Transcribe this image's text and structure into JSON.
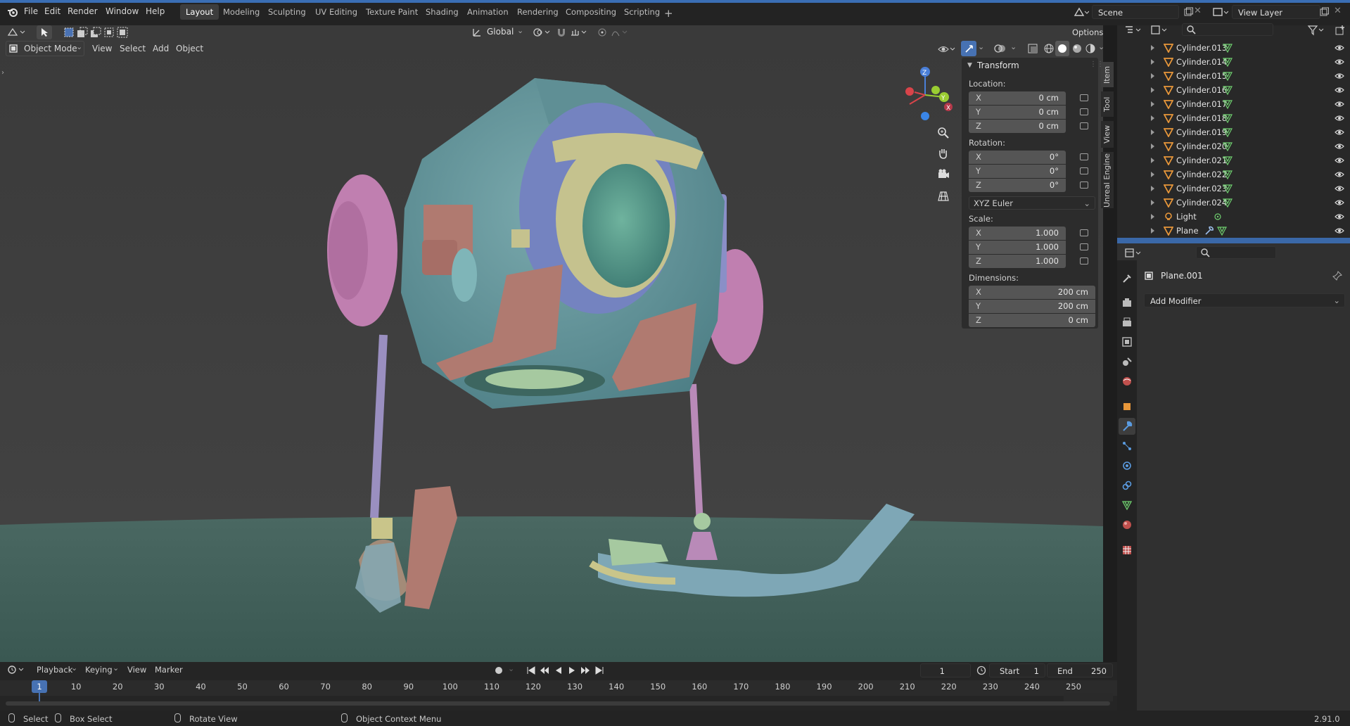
{
  "menu": [
    "File",
    "Edit",
    "Render",
    "Window",
    "Help"
  ],
  "workspaces": [
    {
      "label": "Layout",
      "active": true
    },
    {
      "label": "Modeling",
      "active": false
    },
    {
      "label": "Sculpting",
      "active": false
    },
    {
      "label": "UV Editing",
      "active": false
    },
    {
      "label": "Texture Paint",
      "active": false
    },
    {
      "label": "Shading",
      "active": false
    },
    {
      "label": "Animation",
      "active": false
    },
    {
      "label": "Rendering",
      "active": false
    },
    {
      "label": "Compositing",
      "active": false
    },
    {
      "label": "Scripting",
      "active": false
    }
  ],
  "add_workspace": "+",
  "scene": {
    "name": "Scene"
  },
  "view_layer": {
    "name": "View Layer"
  },
  "toolbar": {
    "orientation": "Global",
    "options": "Options"
  },
  "viewport_header": {
    "mode": "Object Mode",
    "menus": [
      "View",
      "Select",
      "Add",
      "Object"
    ]
  },
  "npanel": {
    "section": "Transform",
    "location_label": "Location:",
    "location": [
      {
        "axis": "X",
        "value": "0 cm"
      },
      {
        "axis": "Y",
        "value": "0 cm"
      },
      {
        "axis": "Z",
        "value": "0 cm"
      }
    ],
    "rotation_label": "Rotation:",
    "rotation": [
      {
        "axis": "X",
        "value": "0°"
      },
      {
        "axis": "Y",
        "value": "0°"
      },
      {
        "axis": "Z",
        "value": "0°"
      }
    ],
    "rotation_mode": "XYZ Euler",
    "scale_label": "Scale:",
    "scale": [
      {
        "axis": "X",
        "value": "1.000"
      },
      {
        "axis": "Y",
        "value": "1.000"
      },
      {
        "axis": "Z",
        "value": "1.000"
      }
    ],
    "dimensions_label": "Dimensions:",
    "dimensions": [
      {
        "axis": "X",
        "value": "200 cm"
      },
      {
        "axis": "Y",
        "value": "200 cm"
      },
      {
        "axis": "Z",
        "value": "0 cm"
      }
    ],
    "tabs": [
      "Item",
      "Tool",
      "View",
      "Unreal Engine"
    ]
  },
  "outliner": {
    "items": [
      {
        "name": "Cylinder.013",
        "type": "mesh"
      },
      {
        "name": "Cylinder.014",
        "type": "mesh"
      },
      {
        "name": "Cylinder.015",
        "type": "mesh"
      },
      {
        "name": "Cylinder.016",
        "type": "mesh"
      },
      {
        "name": "Cylinder.017",
        "type": "mesh"
      },
      {
        "name": "Cylinder.018",
        "type": "mesh"
      },
      {
        "name": "Cylinder.019",
        "type": "mesh"
      },
      {
        "name": "Cylinder.020",
        "type": "mesh"
      },
      {
        "name": "Cylinder.021",
        "type": "mesh"
      },
      {
        "name": "Cylinder.022",
        "type": "mesh"
      },
      {
        "name": "Cylinder.023",
        "type": "mesh"
      },
      {
        "name": "Cylinder.024",
        "type": "mesh"
      },
      {
        "name": "Light",
        "type": "light"
      },
      {
        "name": "Plane",
        "type": "mesh-modifier"
      }
    ]
  },
  "properties": {
    "object_name": "Plane.001",
    "add_modifier": "Add Modifier"
  },
  "timeline": {
    "menus": [
      "Playback",
      "Keying",
      "View",
      "Marker"
    ],
    "current_frame": "1",
    "start_label": "Start",
    "start": "1",
    "end_label": "End",
    "end": "250",
    "ticks": [
      "10",
      "20",
      "30",
      "40",
      "50",
      "60",
      "70",
      "80",
      "90",
      "100",
      "110",
      "120",
      "130",
      "140",
      "150",
      "160",
      "170",
      "180",
      "190",
      "200",
      "210",
      "220",
      "230",
      "240",
      "250"
    ],
    "playhead": "1"
  },
  "statusbar": {
    "select": "Select",
    "box_select": "Box Select",
    "rotate_view": "Rotate View",
    "context_menu": "Object Context Menu",
    "version": "2.91.0"
  },
  "colors": {
    "accent": "#4772b3",
    "mesh_icon": "#e8973a",
    "data_icon": "#6fcf6f"
  }
}
